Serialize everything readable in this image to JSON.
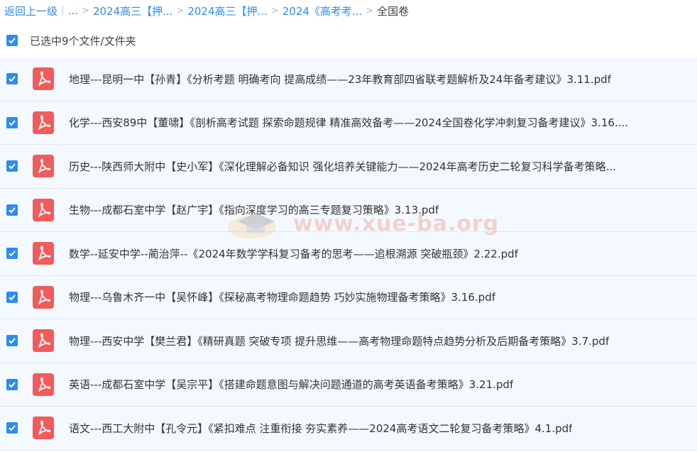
{
  "breadcrumb": {
    "back": "返回上一级",
    "ellipsis": "...",
    "items": [
      "2024高三【押...",
      "2024高三【押...",
      "2024《高考考..."
    ],
    "current": "全国卷"
  },
  "selection": {
    "label": "已选中9个文件/文件夹",
    "checked": true
  },
  "files": [
    {
      "name": "地理---昆明一中【孙青】《分析考题 明确考向 提高成绩——23年教育部四省联考题解析及24年备考建议》3.11.pdf",
      "checked": true,
      "icon": "pdf-icon"
    },
    {
      "name": "化学---西安89中【董啸】《剖析高考试题 探索命题规律 精准高效备考——2024全国卷化学冲刺复习备考建议》3.16....",
      "checked": true,
      "icon": "pdf-icon"
    },
    {
      "name": "历史---陕西师大附中【史小军】《深化理解必备知识 强化培养关键能力——2024年高考历史二轮复习科学备考策略...",
      "checked": true,
      "icon": "pdf-icon"
    },
    {
      "name": "生物---成都石室中学【赵广宇】《指向深度学习的高三专题复习策略》3.13.pdf",
      "checked": true,
      "icon": "pdf-icon"
    },
    {
      "name": "数学--延安中学--蔺治萍--《2024年数学学科复习备考的思考——追根溯源 突破瓶颈》2.22.pdf",
      "checked": true,
      "icon": "pdf-icon"
    },
    {
      "name": "物理---乌鲁木齐一中【吴怀峰】《探秘高考物理命题趋势 巧妙实施物理备考策略》3.16.pdf",
      "checked": true,
      "icon": "pdf-icon"
    },
    {
      "name": "物理---西安中学【樊兰君】《精研真题 突破专项 提升思维——高考物理命题特点趋势分析及后期备考策略》3.7.pdf",
      "checked": true,
      "icon": "pdf-icon"
    },
    {
      "name": "英语---成都石室中学【吴宗平】《搭建命题意图与解决问题通道的高考英语备考策略》3.21.pdf",
      "checked": true,
      "icon": "pdf-icon"
    },
    {
      "name": "语文---西工大附中【孔令元】《紧扣难点 注重衔接 夯实素养——2024高考语文二轮复习备考策略》4.1.pdf",
      "checked": true,
      "icon": "pdf-icon"
    }
  ],
  "watermark": {
    "text": "www.xue-ba.org"
  },
  "colors": {
    "accent": "#2d8cf0",
    "pdf": "#f25b5b",
    "row_bg": "#f4f9ff"
  }
}
